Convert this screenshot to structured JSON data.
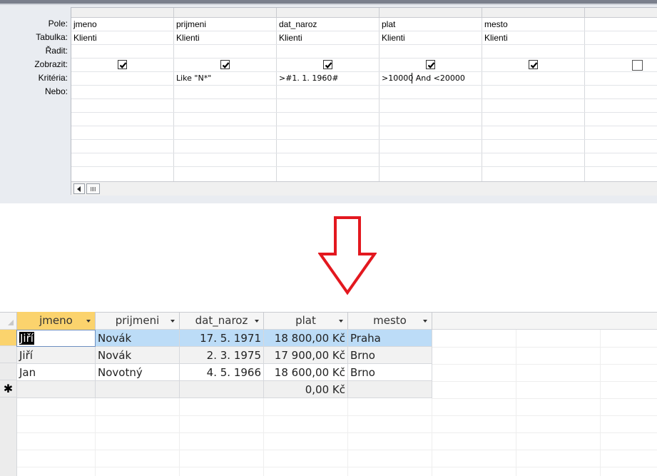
{
  "design": {
    "row_labels": [
      "Pole:",
      "Tabulka:",
      "Řadit:",
      "Zobrazit:",
      "Kritéria:",
      "Nebo:"
    ],
    "columns": [
      {
        "field": "jmeno",
        "table": "Klienti",
        "show": true,
        "criteria": ""
      },
      {
        "field": "prijmeni",
        "table": "Klienti",
        "show": true,
        "criteria": "Like \"N*\""
      },
      {
        "field": "dat_naroz",
        "table": "Klienti",
        "show": true,
        "criteria": ">#1. 1. 1960#"
      },
      {
        "field": "plat",
        "table": "Klienti",
        "show": true,
        "criteria": ">10000 And <20000"
      },
      {
        "field": "mesto",
        "table": "Klienti",
        "show": true,
        "criteria": ""
      },
      {
        "field": "",
        "table": "",
        "show": false,
        "criteria": ""
      }
    ]
  },
  "arrow": {
    "icon": "down-arrow-icon",
    "color": "#e3181f"
  },
  "datasheet": {
    "headers": [
      "jmeno",
      "prijmeni",
      "dat_naroz",
      "plat",
      "mesto"
    ],
    "rows": [
      [
        "Jiří",
        "Novák",
        "17. 5. 1971",
        "18 800,00 Kč",
        "Praha"
      ],
      [
        "Jiří",
        "Novák",
        "2. 3. 1975",
        "17 900,00 Kč",
        "Brno"
      ],
      [
        "Jan",
        "Novotný",
        "4. 5. 1966",
        "18 600,00 Kč",
        "Brno"
      ]
    ],
    "new_row_symbol": "✱",
    "new_row_plat": "0,00 Kč"
  },
  "colors": {
    "active_header": "#fbd36d",
    "selected_row": "#bcdcf7"
  }
}
